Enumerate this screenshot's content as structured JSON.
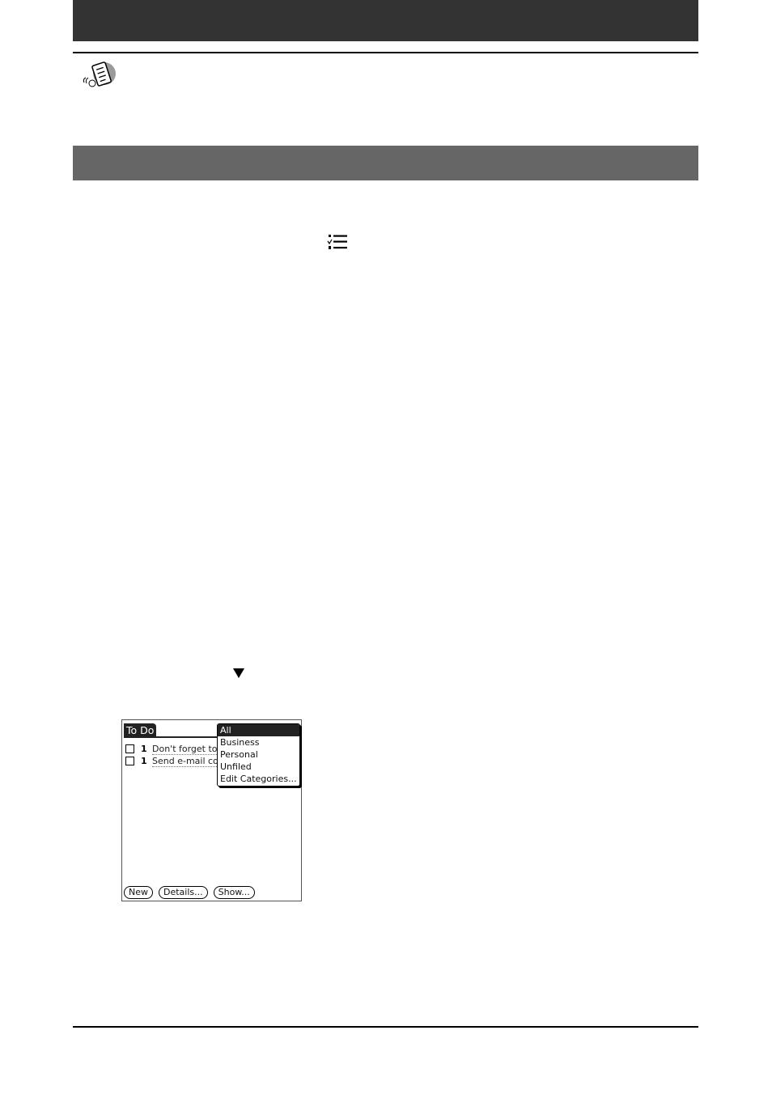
{
  "page": {
    "header_band": "",
    "section_band": ""
  },
  "icons": {
    "tip": "tip-handheld-icon",
    "menu": "menu-list-icon",
    "dropdown_arrow": "down-triangle-icon"
  },
  "palm": {
    "app_title": "To Do",
    "todos": [
      {
        "priority": "1",
        "description": "Don't forget to",
        "checked": false
      },
      {
        "priority": "1",
        "description": "Send e-mail co",
        "checked": false
      }
    ],
    "category_menu": {
      "items": [
        "All",
        "Business",
        "Personal",
        "Unfiled",
        "Edit Categories..."
      ],
      "selected": "All"
    },
    "buttons": {
      "new": "New",
      "details": "Details...",
      "show": "Show..."
    }
  },
  "colors": {
    "header_band": "#333333",
    "section_band": "#666666",
    "rule": "#000000"
  }
}
